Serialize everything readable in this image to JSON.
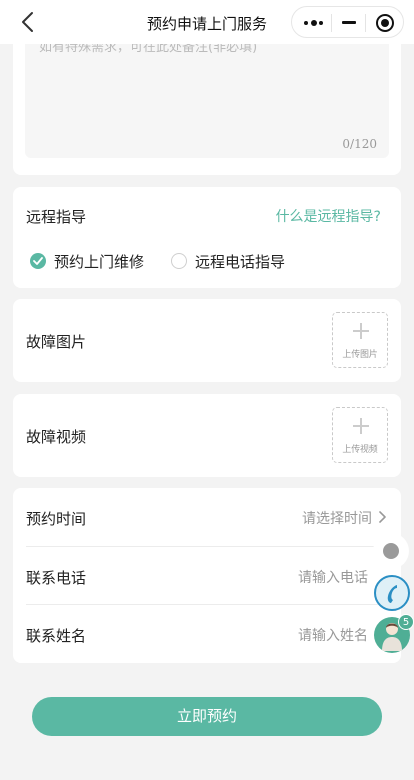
{
  "header": {
    "title": "预约申请上门服务",
    "back_icon": "chevron-left-icon",
    "capsule_icons": [
      "more-dots-icon",
      "minimize-icon",
      "close-circle-icon"
    ]
  },
  "notes": {
    "placeholder": "如有特殊需求，可在此处备注(非必填)",
    "count": "0/120"
  },
  "remote": {
    "title": "远程指导",
    "link": "什么是远程指导?",
    "options": [
      {
        "label": "预约上门维修",
        "selected": true
      },
      {
        "label": "远程电话指导",
        "selected": false
      }
    ]
  },
  "photo": {
    "label": "故障图片",
    "upload_text": "上传图片"
  },
  "video": {
    "label": "故障视频",
    "upload_text": "上传视频"
  },
  "form": {
    "time": {
      "label": "预约时间",
      "placeholder": "请选择时间"
    },
    "phone": {
      "label": "联系电话",
      "placeholder": "请输入电话"
    },
    "name": {
      "label": "联系姓名",
      "placeholder": "请输入姓名"
    }
  },
  "submit_label": "立即预约",
  "floating": {
    "badge_count": "5"
  },
  "colors": {
    "accent": "#5ab8a3",
    "background": "#f3f3f3"
  }
}
